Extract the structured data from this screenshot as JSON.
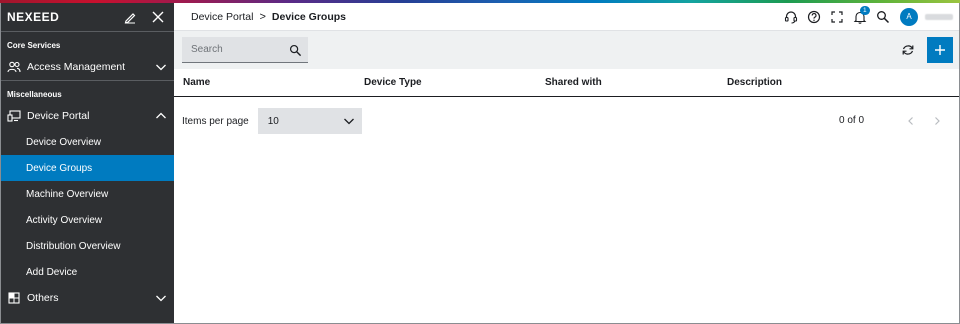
{
  "brand": {
    "name": "NEXEED"
  },
  "sidebar": {
    "sections": [
      {
        "label": "Core Services"
      },
      {
        "label": "Miscellaneous"
      }
    ],
    "groups": {
      "access": {
        "label": "Access Management",
        "icon": "people-icon"
      },
      "device_portal": {
        "label": "Device Portal",
        "icon": "devices-icon"
      },
      "others": {
        "label": "Others",
        "icon": "grid-icon"
      }
    },
    "subitems": [
      {
        "label": "Device Overview",
        "active": false
      },
      {
        "label": "Device Groups",
        "active": true
      },
      {
        "label": "Machine Overview",
        "active": false
      },
      {
        "label": "Activity Overview",
        "active": false
      },
      {
        "label": "Distribution Overview",
        "active": false
      },
      {
        "label": "Add Device",
        "active": false
      }
    ]
  },
  "header": {
    "breadcrumb": {
      "parent": "Device Portal",
      "separator": ">",
      "current": "Device Groups"
    },
    "notification_count": "1",
    "avatar_initial": "A"
  },
  "toolbar": {
    "search_placeholder": "Search"
  },
  "table": {
    "columns": [
      "Name",
      "Device Type",
      "Shared with",
      "Description"
    ]
  },
  "pager": {
    "items_per_page_label": "Items per page",
    "items_per_page_value": "10",
    "range_text": "0 of 0"
  },
  "colors": {
    "accent": "#007bc0",
    "sidebar_bg": "#2e3033",
    "toolbar_bg": "#eff1f2"
  }
}
